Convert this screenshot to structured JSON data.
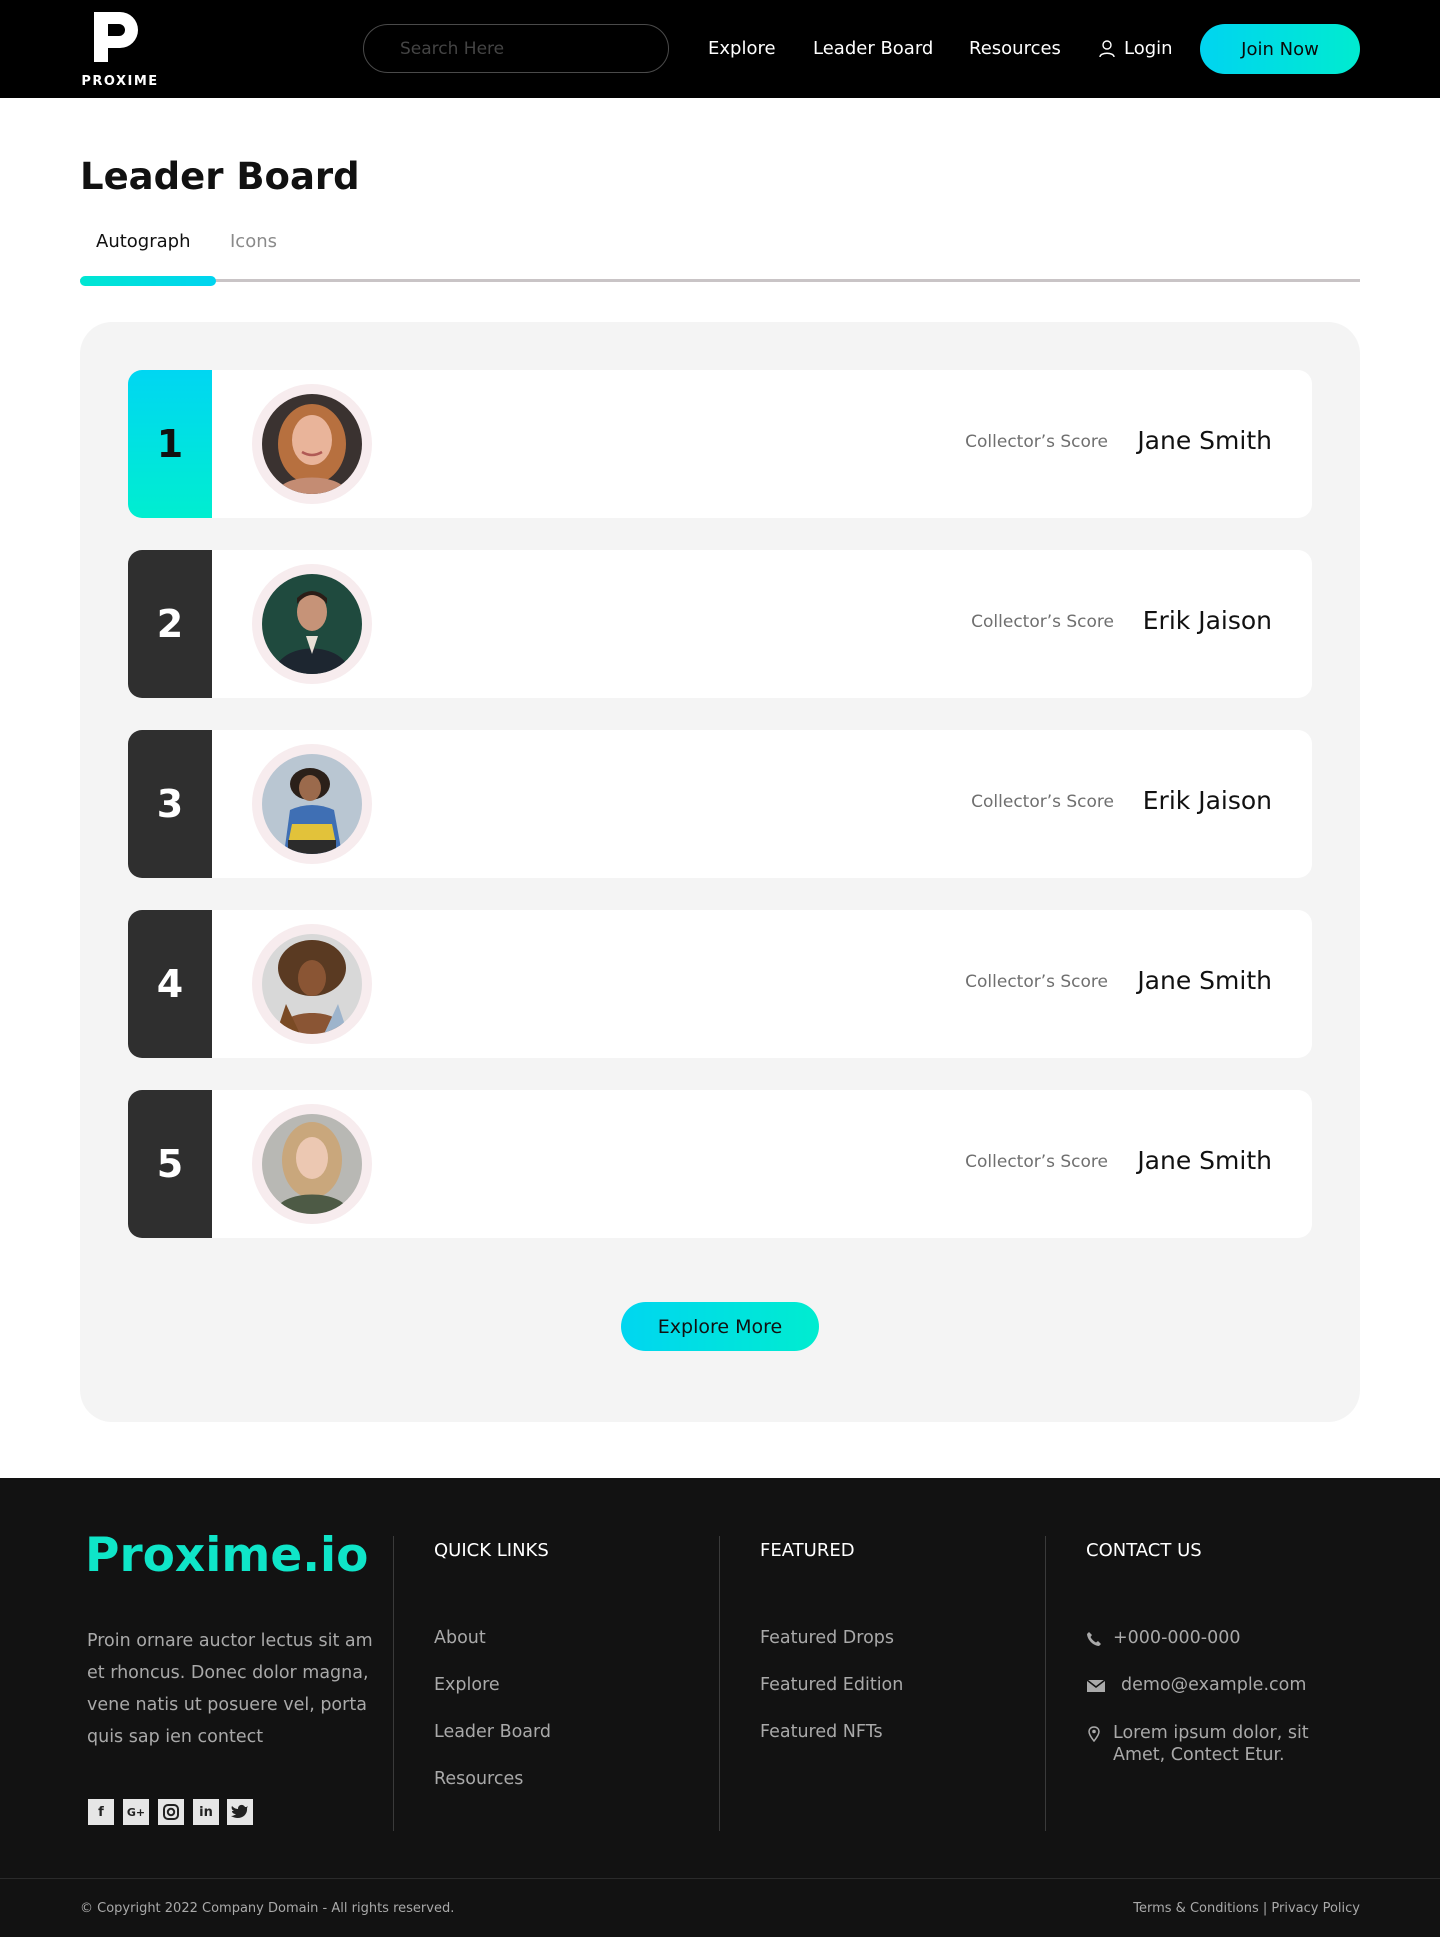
{
  "header": {
    "logo_text": "PROXIME",
    "search_placeholder": "Search Here",
    "nav": [
      "Explore",
      "Leader Board",
      "Resources",
      "Login"
    ],
    "join_label": "Join Now"
  },
  "page": {
    "title": "Leader Board",
    "tabs": [
      "Autograph",
      "Icons"
    ],
    "active_tab": "Autograph"
  },
  "leaderboard": {
    "rows": [
      {
        "rank": "1",
        "score_label": "Collector’s Score",
        "name": "Jane Smith"
      },
      {
        "rank": "2",
        "score_label": "Collector’s Score",
        "name": "Erik Jaison"
      },
      {
        "rank": "3",
        "score_label": "Collector’s Score",
        "name": "Erik Jaison"
      },
      {
        "rank": "4",
        "score_label": "Collector’s Score",
        "name": "Jane Smith"
      },
      {
        "rank": "5",
        "score_label": "Collector’s Score",
        "name": "Jane Smith"
      }
    ],
    "explore_label": "Explore More"
  },
  "footer": {
    "brand": "Proxime.io",
    "about": "Proin ornare auctor lectus sit am et rhoncus. Donec dolor magna, vene natis ut posuere vel, porta quis sap ien contect",
    "social": [
      "facebook-icon",
      "google-plus-icon",
      "instagram-icon",
      "linkedin-icon",
      "twitter-icon"
    ],
    "quick_links_title": "QUICK LINKS",
    "quick_links": [
      "About",
      "Explore",
      "Leader Board",
      "Resources"
    ],
    "featured_title": "FEATURED",
    "featured": [
      "Featured Drops",
      "Featured Edition",
      "Featured NFTs"
    ],
    "contact_title": "CONTACT US",
    "phone": "+000-000-000",
    "email": "demo@example.com",
    "address_line1": "Lorem ipsum dolor, sit",
    "address_line2": "Amet, Contect Etur.",
    "copyright": "© Copyright 2022 Company Domain - All rights reserved.",
    "legal": "Terms & Conditions | Privacy Policy"
  },
  "colors": {
    "accent": "#00e0e0",
    "brand_green": "#0fe5c8",
    "dark": "#2f2f2f"
  }
}
